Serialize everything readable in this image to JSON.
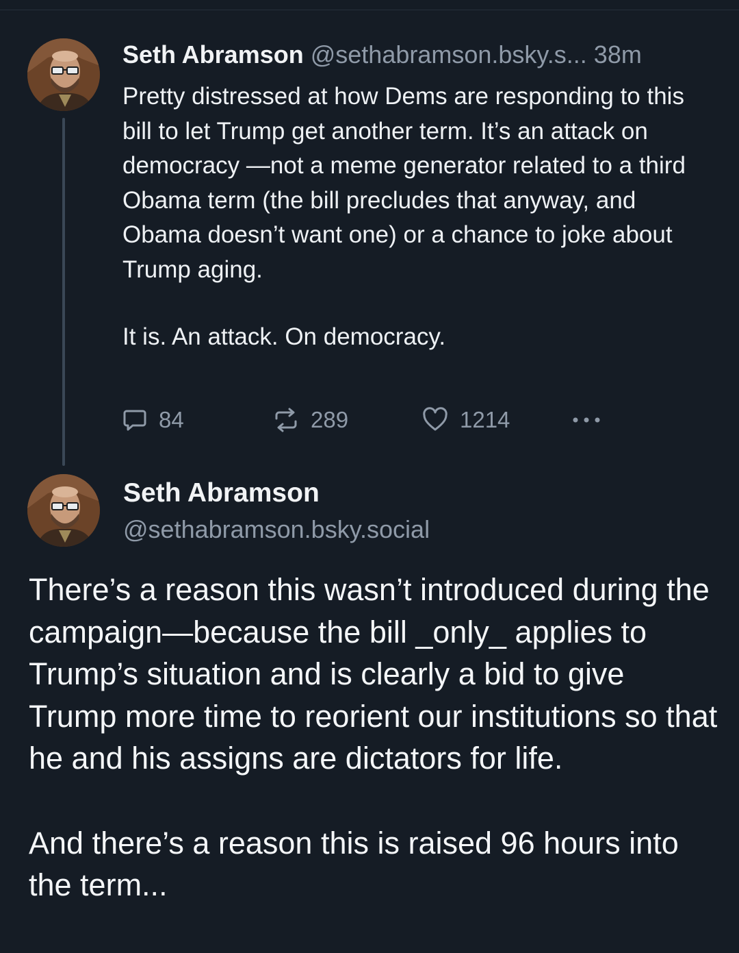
{
  "parent_post": {
    "author_name": "Seth Abramson",
    "author_handle": "@sethabramson.bsky.s...",
    "time": "38m",
    "body_paragraph_1": "Pretty distressed at how Dems are responding to this bill to let Trump get another term. It’s an attack on democracy —not a meme generator related to a third Obama term (the bill precludes that anyway, and Obama doesn’t want one) or a chance to joke about Trump aging.",
    "body_paragraph_2": "It is. An attack. On democracy.",
    "reply_count": "84",
    "repost_count": "289",
    "like_count": "1214",
    "avatar_icon": "avatar-photo-icon"
  },
  "main_post": {
    "author_name": "Seth Abramson",
    "author_handle": "@sethabramson.bsky.social",
    "body_paragraph_1": "There’s a reason this wasn’t introduced during the campaign—because the bill _only_ applies to Trump’s situation and is clearly a bid to give Trump more time to reorient our institutions so that he and his assigns are dictators for life.",
    "body_paragraph_2": "And there’s a reason this is raised 96 hours into the term...",
    "avatar_icon": "avatar-photo-icon"
  },
  "icons": {
    "reply": "reply-bubble-icon",
    "repost": "repost-arrows-icon",
    "like": "heart-icon",
    "more": "more-dots-icon"
  },
  "colors": {
    "background": "#151c25",
    "text_primary": "#f1f3f5",
    "text_secondary": "#8f9aa8",
    "thread_line": "#3a4756"
  }
}
